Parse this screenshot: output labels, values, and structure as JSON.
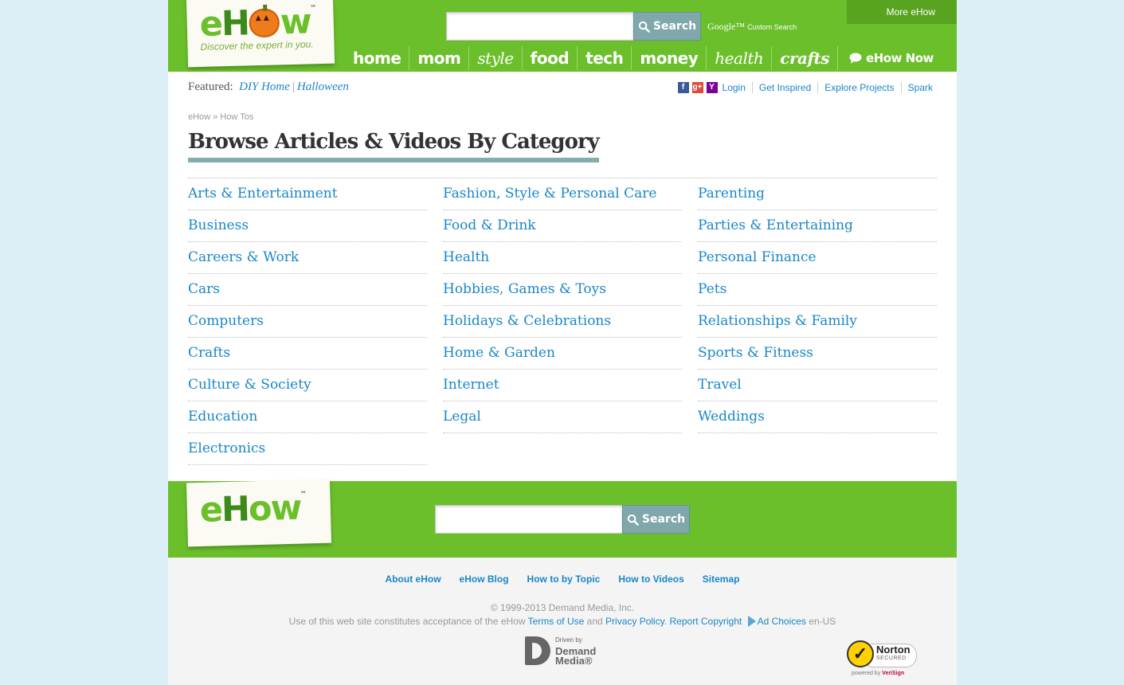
{
  "header": {
    "logo": {
      "word_e": "e",
      "word_h": "H",
      "word_ow": "w",
      "tm": "™",
      "tagline": "Discover the expert in you."
    },
    "search": {
      "placeholder": "",
      "button_label": "Search"
    },
    "google": {
      "brand": "Google™",
      "label": "Custom Search"
    },
    "more_ehow": "More eHow",
    "nav": [
      "home",
      "mom",
      "style",
      "food",
      "tech",
      "money",
      "health",
      "crafts"
    ],
    "nav_now": "eHow Now"
  },
  "featured": {
    "label": "Featured:",
    "links": [
      "DIY Home",
      "Halloween"
    ]
  },
  "toplinks": {
    "login": "Login",
    "links": [
      "Get Inspired",
      "Explore Projects",
      "Spark"
    ]
  },
  "breadcrumb": {
    "home": "eHow",
    "sep": "»",
    "current": "How Tos"
  },
  "page_title": "Browse Articles & Videos By Category",
  "categories": {
    "col1": [
      "Arts & Entertainment",
      "Business",
      "Careers & Work",
      "Cars",
      "Computers",
      "Crafts",
      "Culture & Society",
      "Education",
      "Electronics"
    ],
    "col2": [
      "Fashion, Style & Personal Care",
      "Food & Drink",
      "Health",
      "Hobbies, Games & Toys",
      "Holidays & Celebrations",
      "Home & Garden",
      "Internet",
      "Legal"
    ],
    "col3": [
      "Parenting",
      "Parties & Entertaining",
      "Personal Finance",
      "Pets",
      "Relationships & Family",
      "Sports & Fitness",
      "Travel",
      "Weddings"
    ]
  },
  "footer": {
    "logo": {
      "word_e": "e",
      "word_h": "H",
      "word_ow": "ow",
      "tm": "™"
    },
    "search": {
      "placeholder": "",
      "button_label": "Search"
    },
    "links": [
      "About eHow",
      "eHow Blog",
      "How to by Topic",
      "How to Videos",
      "Sitemap"
    ],
    "copyright": "© 1999-2013 Demand Media, Inc.",
    "legal": {
      "prefix": "Use of this web site constitutes acceptance of the eHow",
      "terms": "Terms of Use",
      "and": "and",
      "privacy": "Privacy Policy",
      "dot": ".",
      "report": "Report Copyright",
      "adchoices": "Ad Choices",
      "locale": "en-US"
    },
    "demand_media": {
      "small": "Driven by",
      "line1": "Demand",
      "line2": "Media®"
    },
    "norton": {
      "name": "Norton",
      "secured": "SECURED",
      "powered": "powered by",
      "verisign": "VeriSign"
    }
  },
  "colors": {
    "brand_green": "#6abf2b",
    "link_blue": "#1a86c7",
    "rule_teal": "#86adad",
    "background": "#dceef6"
  }
}
